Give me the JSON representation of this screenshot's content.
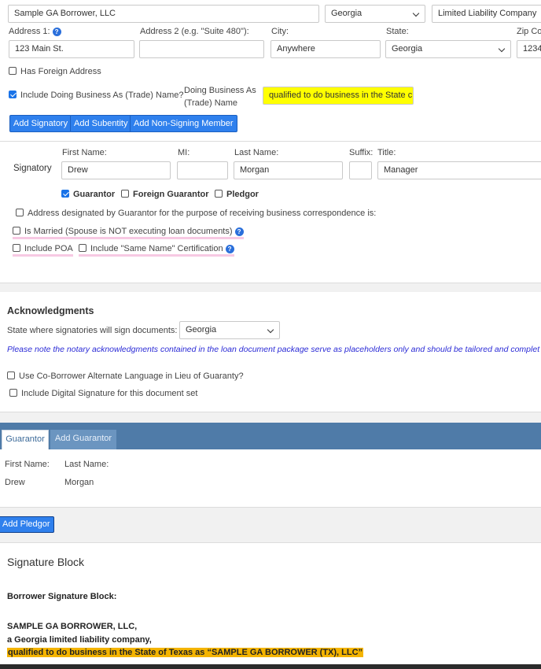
{
  "entity": {
    "name_value": "Sample GA Borrower, LLC",
    "state_value": "Georgia",
    "type_value": "Limited Liability Company"
  },
  "address": {
    "address1_label": "Address 1:",
    "address1_value": "123 Main St.",
    "address2_label": "Address 2 (e.g. \"Suite 480\"):",
    "address2_value": "",
    "city_label": "City:",
    "city_value": "Anywhere",
    "state_label": "State:",
    "state_value": "Georgia",
    "zip_label": "Zip Co",
    "zip_value": "1234",
    "foreign_label": "Has Foreign Address",
    "foreign_checked": false
  },
  "dba": {
    "checkbox_label": "Include Doing Business As (Trade) Name?",
    "checked": true,
    "field_label_line1": "Doing Business As",
    "field_label_line2": "(Trade) Name",
    "value": "qualified to do business in the State c"
  },
  "action_buttons": {
    "add_signatory": "Add Signatory",
    "add_subentity": "Add Subentity",
    "add_non_signing": "Add Non-Signing Member"
  },
  "signatory": {
    "row_label": "Signatory",
    "first_name_label": "First Name:",
    "first_name_value": "Drew",
    "mi_label": "MI:",
    "mi_value": "",
    "last_name_label": "Last Name:",
    "last_name_value": "Morgan",
    "suffix_label": "Suffix:",
    "suffix_value": "",
    "title_label": "Title:",
    "title_value": "Manager",
    "guarantor_label": "Guarantor",
    "foreign_guarantor_label": "Foreign Guarantor",
    "pledgor_label": "Pledgor",
    "address_designated_label": "Address designated by Guarantor for the purpose of receiving business correspondence is:",
    "is_married_label": "Is Married (Spouse is NOT executing loan documents)",
    "include_poa_label": "Include POA",
    "same_name_label": "Include \"Same Name\" Certification"
  },
  "acknowledgments": {
    "heading": "Acknowledgments",
    "state_label": "State where signatories will sign documents:",
    "state_value": "Georgia",
    "notice": "Please note the notary acknowledgments contained in the loan document package serve as placeholders only and should be tailored and complet",
    "co_borrower_label": "Use Co-Borrower Alternate Language in Lieu of Guaranty?",
    "digital_signature_label": "Include Digital Signature for this document set"
  },
  "guarantor_tabs": {
    "tab_guarantor": "Guarantor",
    "tab_add_guarantor": "Add Guarantor",
    "first_name_label": "First Name:",
    "last_name_label": "Last Name:",
    "first_name_value": "Drew",
    "last_name_value": "Morgan"
  },
  "pledgor": {
    "add_pledgor": "Add Pledgor"
  },
  "signature_block": {
    "heading": "Signature Block",
    "subheading": "Borrower Signature Block:",
    "line1": "SAMPLE GA BORROWER, LLC,",
    "line2": "a Georgia limited liability company,",
    "line3": "qualified to do business in the State of Texas as “SAMPLE GA BORROWER (TX), LLC”"
  },
  "colors": {
    "accent_blue": "#2f80ed",
    "tab_bar": "#4f7ba8",
    "highlight_yellow": "#ffff00",
    "highlight_orange": "#f4b400",
    "notice_text": "#2b2bd6"
  },
  "icons": [
    "help-icon",
    "chevron-down-icon",
    "checkbox-icon"
  ]
}
